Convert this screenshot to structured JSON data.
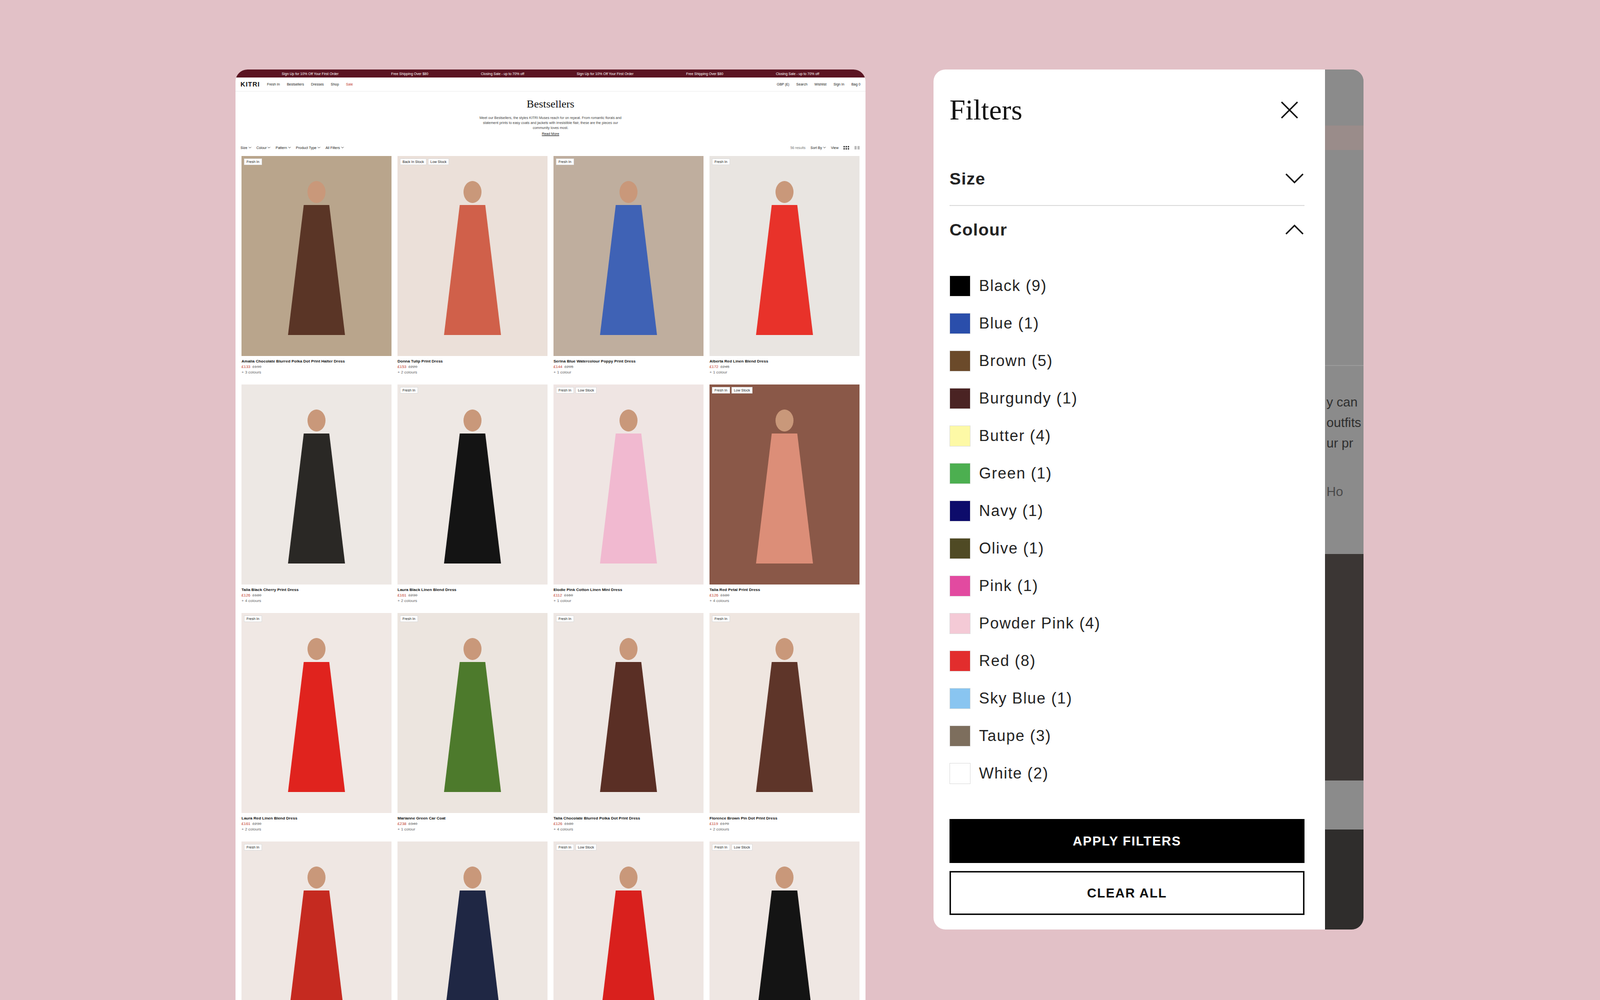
{
  "mockup": {
    "announcements": [
      "Sign Up for 10% Off Your First Order",
      "Free Shipping Over $80",
      "Closing Sale - up to 70% off",
      "Sign Up for 10% Off Your First Order",
      "Free Shipping Over $80",
      "Closing Sale - up to 70% off"
    ],
    "logo": "KITRI",
    "nav": [
      "Fresh In",
      "Bestsellers",
      "Dresses",
      "Shop",
      "Sale"
    ],
    "utility": [
      "GBP (£)",
      "Search",
      "Wishlist",
      "Sign In",
      "Bag 0"
    ],
    "title": "Bestsellers",
    "description": "Meet our Bestsellers, the styles KITRI Muses reach for on repeat. From romantic florals and statement prints to easy coats and jackets with irresistible flair, these are the pieces our community loves most.",
    "read_more": "Read More",
    "filters": [
      "Size",
      "Colour",
      "Pattern",
      "Product Type",
      "All Filters"
    ],
    "results": "56 results",
    "sort": "Sort By",
    "view": "View",
    "products": [
      {
        "name": "Amalia Chocolate Blurred Polka Dot Print Halter Dress",
        "price": "£133",
        "old_price": "£190",
        "colours": "+ 3 colours",
        "badges": [
          "Fresh In"
        ],
        "photo": "#b9a58c",
        "dress": "#5a3526"
      },
      {
        "name": "Donna Tulip Print Dress",
        "price": "£153",
        "old_price": "£220",
        "colours": "+ 2 colours",
        "badges": [
          "Back In Stock",
          "Low Stock"
        ],
        "photo": "#ebe0d9",
        "dress": "#d0604a"
      },
      {
        "name": "Serina Blue Watercolour Poppy Print Dress",
        "price": "£144",
        "old_price": "£205",
        "colours": "+ 1 colour",
        "badges": [
          "Fresh In"
        ],
        "photo": "#bfae9e",
        "dress": "#3f62b5"
      },
      {
        "name": "Alberta Red Linen Blend Dress",
        "price": "£172",
        "old_price": "£245",
        "colours": "+ 1 colour",
        "badges": [
          "Fresh In"
        ],
        "photo": "#e9e5e1",
        "dress": "#e8322a"
      },
      {
        "name": "Talia Black Cherry Print Dress",
        "price": "£126",
        "old_price": "£180",
        "colours": "+ 4 colours",
        "badges": [],
        "photo": "#ede8e4",
        "dress": "#2a2825"
      },
      {
        "name": "Laura Black Linen Blend Dress",
        "price": "£161",
        "old_price": "£230",
        "colours": "+ 2 colours",
        "badges": [
          "Fresh In"
        ],
        "photo": "#eee8e4",
        "dress": "#141414"
      },
      {
        "name": "Elodie Pink Cotton Linen Mini Dress",
        "price": "£112",
        "old_price": "£160",
        "colours": "+ 1 colour",
        "badges": [
          "Fresh In",
          "Low Stock"
        ],
        "photo": "#efe5e3",
        "dress": "#f1b9d0"
      },
      {
        "name": "Talia Red Petal Print Dress",
        "price": "£126",
        "old_price": "£180",
        "colours": "+ 4 colours",
        "badges": [
          "Fresh In",
          "Low Stock"
        ],
        "photo": "#8a5848",
        "dress": "#dc8e78"
      },
      {
        "name": "Laura Red Linen Blend Dress",
        "price": "£161",
        "old_price": "£230",
        "colours": "+ 2 colours",
        "badges": [
          "Fresh In"
        ],
        "photo": "#f0e8e4",
        "dress": "#e0231e"
      },
      {
        "name": "Marianne Green Car Coat",
        "price": "£238",
        "old_price": "£340",
        "colours": "+ 1 colour",
        "badges": [
          "Fresh In"
        ],
        "photo": "#ece5df",
        "dress": "#4d7a2c"
      },
      {
        "name": "Talia Chocolate Blurred Polka Dot Print Dress",
        "price": "£126",
        "old_price": "£180",
        "colours": "+ 4 colours",
        "badges": [
          "Fresh In"
        ],
        "photo": "#eee7e3",
        "dress": "#5a2f25"
      },
      {
        "name": "Florence Brown Pin Dot Print Dress",
        "price": "£119",
        "old_price": "£170",
        "colours": "+ 2 colours",
        "badges": [
          "Fresh In"
        ],
        "photo": "#efe6e0",
        "dress": "#5e3529"
      },
      {
        "badges": [
          "Fresh In"
        ],
        "photo": "#efe7e3",
        "dress": "#c52a20"
      },
      {
        "badges": [],
        "photo": "#ede6e1",
        "dress": "#1f2744"
      },
      {
        "badges": [
          "Fresh In",
          "Low Stock"
        ],
        "photo": "#eee6e2",
        "dress": "#d9201d"
      },
      {
        "badges": [
          "Fresh In",
          "Low Stock"
        ],
        "photo": "#efe7e3",
        "dress": "#141414"
      }
    ]
  },
  "filter_panel": {
    "title": "Filters",
    "sections": [
      {
        "label": "Size",
        "expanded": false,
        "options": []
      },
      {
        "label": "Colour",
        "expanded": true,
        "options": [
          {
            "label": "Black (9)",
            "color": "#000000"
          },
          {
            "label": "Blue (1)",
            "color": "#2a4eab"
          },
          {
            "label": "Brown (5)",
            "color": "#6b4a2a"
          },
          {
            "label": "Burgundy (1)",
            "color": "#4a2323"
          },
          {
            "label": "Butter (4)",
            "color": "#fdf9a6"
          },
          {
            "label": "Green (1)",
            "color": "#4caf50"
          },
          {
            "label": "Navy (1)",
            "color": "#0d0c6b"
          },
          {
            "label": "Olive (1)",
            "color": "#4f4a24"
          },
          {
            "label": "Pink (1)",
            "color": "#e24aa0"
          },
          {
            "label": "Powder Pink (4)",
            "color": "#f4cad6"
          },
          {
            "label": "Red (8)",
            "color": "#e22d2d"
          },
          {
            "label": "Sky Blue (1)",
            "color": "#89c5f0"
          },
          {
            "label": "Taupe (3)",
            "color": "#7d6e5d"
          },
          {
            "label": "White (2)",
            "color": "#ffffff"
          }
        ]
      }
    ],
    "buttons": [
      {
        "label": "APPLY FILTERS",
        "kind": "primary"
      },
      {
        "label": "CLEAR ALL",
        "kind": "secondary"
      }
    ]
  },
  "background_page": {
    "fragments": [
      "y can",
      "outfits",
      "ur pr"
    ],
    "link": "Ho"
  }
}
